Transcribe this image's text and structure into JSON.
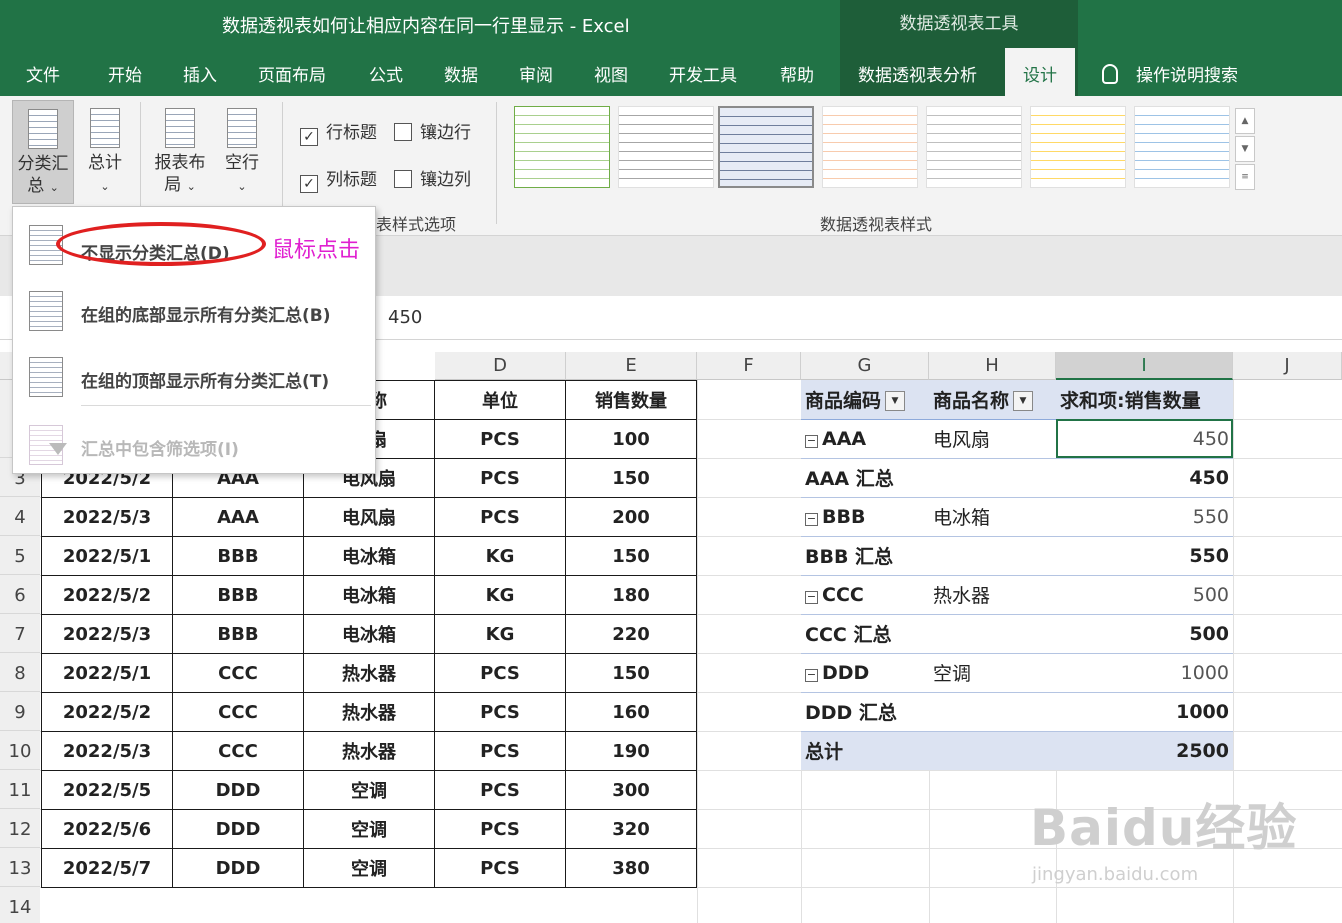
{
  "window": {
    "title": "数据透视表如何让相应内容在同一行里显示  -  Excel",
    "context_tab_header": "数据透视表工具"
  },
  "menu_tabs": [
    "文件",
    "开始",
    "插入",
    "页面布局",
    "公式",
    "数据",
    "审阅",
    "视图",
    "开发工具",
    "帮助",
    "数据透视表分析",
    "设计",
    "操作说明搜索"
  ],
  "active_tab": "设计",
  "ribbon": {
    "subtotals_label": "分类汇总",
    "subtotals_label_line1": "分类汇",
    "subtotals_label_line2": "总",
    "grand_totals_label": "总计",
    "report_layout_line1": "报表布",
    "report_layout_line2": "局",
    "blank_rows_label": "空行",
    "options": {
      "row_headers": {
        "label": "行标题",
        "checked": true
      },
      "banded_rows": {
        "label": "镶边行",
        "checked": false
      },
      "column_headers": {
        "label": "列标题",
        "checked": true
      },
      "banded_columns": {
        "label": "镶边列",
        "checked": false
      }
    },
    "style_options_group_label": "表样式选项",
    "styles_group_label": "数据透视表样式",
    "style_swatches": [
      {
        "name": "style-green-outline",
        "accent": "#a9d08e"
      },
      {
        "name": "style-gray",
        "accent": "#a6a6a6"
      },
      {
        "name": "style-blue-selected",
        "accent": "#b4c6e7"
      },
      {
        "name": "style-orange",
        "accent": "#f8cbad"
      },
      {
        "name": "style-light-gray",
        "accent": "#d9d9d9"
      },
      {
        "name": "style-yellow",
        "accent": "#ffe699"
      },
      {
        "name": "style-light-blue",
        "accent": "#bdd7ee"
      }
    ]
  },
  "subtotals_menu": {
    "items": [
      {
        "label": "不显示分类汇总(D)",
        "enabled": true
      },
      {
        "label": "在组的底部显示所有分类汇总(B)",
        "enabled": true
      },
      {
        "label": "在组的顶部显示所有分类汇总(T)",
        "enabled": true
      },
      {
        "label": "汇总中包含筛选项(I)",
        "enabled": false
      }
    ]
  },
  "annotation": {
    "text": "鼠标点击"
  },
  "formula_bar": {
    "value": "450"
  },
  "columns": [
    "D",
    "E",
    "F",
    "G",
    "H",
    "I",
    "J"
  ],
  "rows": [
    "3",
    "4",
    "5",
    "6",
    "7",
    "8",
    "9",
    "10",
    "11",
    "12",
    "13",
    "14"
  ],
  "source_table": {
    "header_partial": [
      "名称",
      "单位",
      "销售数量"
    ],
    "first_row_partial": [
      "风扇",
      "PCS",
      "100"
    ],
    "rows": [
      [
        "2022/5/2",
        "AAA",
        "电风扇",
        "PCS",
        "150"
      ],
      [
        "2022/5/3",
        "AAA",
        "电风扇",
        "PCS",
        "200"
      ],
      [
        "2022/5/1",
        "BBB",
        "电冰箱",
        "KG",
        "150"
      ],
      [
        "2022/5/2",
        "BBB",
        "电冰箱",
        "KG",
        "180"
      ],
      [
        "2022/5/3",
        "BBB",
        "电冰箱",
        "KG",
        "220"
      ],
      [
        "2022/5/1",
        "CCC",
        "热水器",
        "PCS",
        "150"
      ],
      [
        "2022/5/2",
        "CCC",
        "热水器",
        "PCS",
        "160"
      ],
      [
        "2022/5/3",
        "CCC",
        "热水器",
        "PCS",
        "190"
      ],
      [
        "2022/5/5",
        "DDD",
        "空调",
        "PCS",
        "300"
      ],
      [
        "2022/5/6",
        "DDD",
        "空调",
        "PCS",
        "320"
      ],
      [
        "2022/5/7",
        "DDD",
        "空调",
        "PCS",
        "380"
      ]
    ]
  },
  "pivot_table": {
    "headers": [
      "商品编码",
      "商品名称",
      "求和项:销售数量"
    ],
    "groups": [
      {
        "code": "AAA",
        "name": "电风扇",
        "sum": "450",
        "subtotal_label": "AAA 汇总",
        "subtotal": "450"
      },
      {
        "code": "BBB",
        "name": "电冰箱",
        "sum": "550",
        "subtotal_label": "BBB 汇总",
        "subtotal": "550"
      },
      {
        "code": "CCC",
        "name": "热水器",
        "sum": "500",
        "subtotal_label": "CCC 汇总",
        "subtotal": "500"
      },
      {
        "code": "DDD",
        "name": "空调",
        "sum": "1000",
        "subtotal_label": "DDD 汇总",
        "subtotal": "1000"
      }
    ],
    "grand_total_label": "总计",
    "grand_total": "2500"
  },
  "watermark": {
    "logo": "Baidu经验",
    "url": "jingyan.baidu.com"
  },
  "colors": {
    "excel_green": "#217346",
    "pivot_header": "#dce3f2",
    "annotation_red": "#e02020",
    "annotation_magenta": "#e020d0"
  }
}
